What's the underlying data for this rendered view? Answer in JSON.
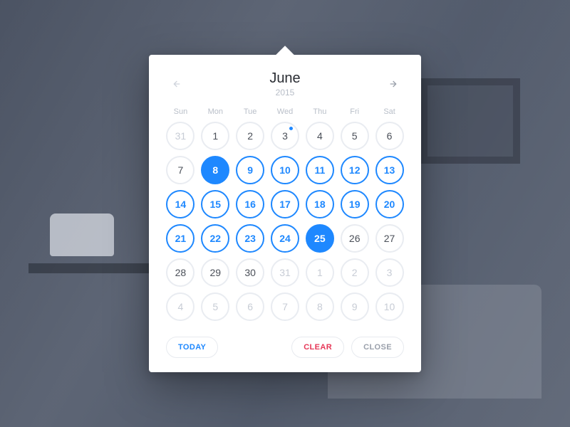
{
  "header": {
    "month": "June",
    "year": "2015"
  },
  "weekdays": [
    "Sun",
    "Mon",
    "Tue",
    "Wed",
    "Thu",
    "Fri",
    "Sat"
  ],
  "days": [
    {
      "n": "31",
      "state": "out"
    },
    {
      "n": "1",
      "state": ""
    },
    {
      "n": "2",
      "state": ""
    },
    {
      "n": "3",
      "state": "",
      "dot": true
    },
    {
      "n": "4",
      "state": ""
    },
    {
      "n": "5",
      "state": ""
    },
    {
      "n": "6",
      "state": ""
    },
    {
      "n": "7",
      "state": ""
    },
    {
      "n": "8",
      "state": "sel"
    },
    {
      "n": "9",
      "state": "range"
    },
    {
      "n": "10",
      "state": "range"
    },
    {
      "n": "11",
      "state": "range"
    },
    {
      "n": "12",
      "state": "range"
    },
    {
      "n": "13",
      "state": "range"
    },
    {
      "n": "14",
      "state": "range"
    },
    {
      "n": "15",
      "state": "range"
    },
    {
      "n": "16",
      "state": "range"
    },
    {
      "n": "17",
      "state": "range"
    },
    {
      "n": "18",
      "state": "range"
    },
    {
      "n": "19",
      "state": "range"
    },
    {
      "n": "20",
      "state": "range"
    },
    {
      "n": "21",
      "state": "range"
    },
    {
      "n": "22",
      "state": "range"
    },
    {
      "n": "23",
      "state": "range"
    },
    {
      "n": "24",
      "state": "range"
    },
    {
      "n": "25",
      "state": "sel"
    },
    {
      "n": "26",
      "state": ""
    },
    {
      "n": "27",
      "state": ""
    },
    {
      "n": "28",
      "state": ""
    },
    {
      "n": "29",
      "state": ""
    },
    {
      "n": "30",
      "state": ""
    },
    {
      "n": "31",
      "state": "out"
    },
    {
      "n": "1",
      "state": "out"
    },
    {
      "n": "2",
      "state": "out"
    },
    {
      "n": "3",
      "state": "out"
    },
    {
      "n": "4",
      "state": "out"
    },
    {
      "n": "5",
      "state": "out"
    },
    {
      "n": "6",
      "state": "out"
    },
    {
      "n": "7",
      "state": "out"
    },
    {
      "n": "8",
      "state": "out"
    },
    {
      "n": "9",
      "state": "out"
    },
    {
      "n": "10",
      "state": "out"
    }
  ],
  "footer": {
    "today": "TODAY",
    "clear": "CLEAR",
    "close": "CLOSE"
  },
  "colors": {
    "accent": "#1e88ff",
    "danger": "#e63757",
    "muted": "#9aa0ab"
  }
}
